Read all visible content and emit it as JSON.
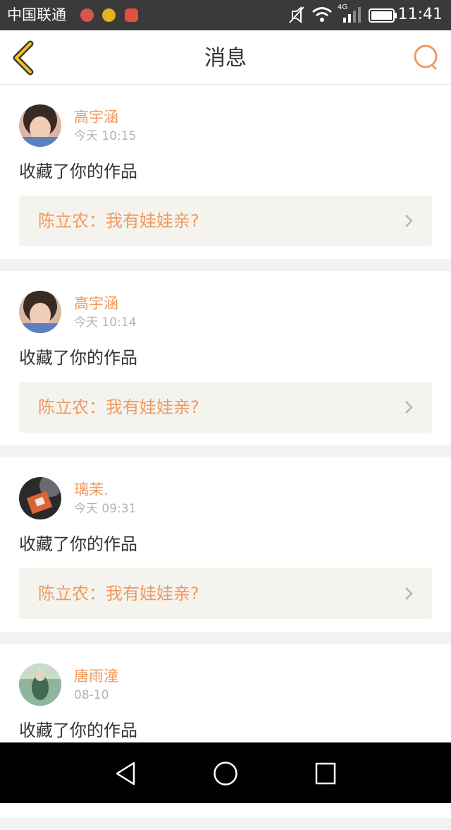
{
  "status_bar": {
    "carrier": "中国联通",
    "time": "11:41",
    "network": "4G",
    "icons": [
      "app-notification-icon",
      "app-notification-icon",
      "app-notification-icon",
      "mute-icon",
      "wifi-icon",
      "signal-icon",
      "battery-icon"
    ]
  },
  "header": {
    "title": "消息",
    "back_icon": "back-chevron-icon",
    "search_icon": "search-icon"
  },
  "colors": {
    "accent": "#f0995f",
    "back_icon": "#f5c12e",
    "card_link_bg": "#f5f3ee"
  },
  "messages": [
    {
      "user": "高宇涵",
      "time": "今天 10:15",
      "action": "收藏了你的作品",
      "work": "陈立农：我有娃娃亲?"
    },
    {
      "user": "高宇涵",
      "time": "今天 10:14",
      "action": "收藏了你的作品",
      "work": "陈立农：我有娃娃亲?"
    },
    {
      "user": "璃茉.",
      "time": "今天 09:31",
      "action": "收藏了你的作品",
      "work": "陈立农：我有娃娃亲?"
    },
    {
      "user": "唐雨潼",
      "time": "08-10",
      "action": "收藏了你的作品",
      "work": ""
    }
  ],
  "android_nav": {
    "icons": [
      "back-triangle-icon",
      "home-circle-icon",
      "recents-square-icon"
    ]
  }
}
